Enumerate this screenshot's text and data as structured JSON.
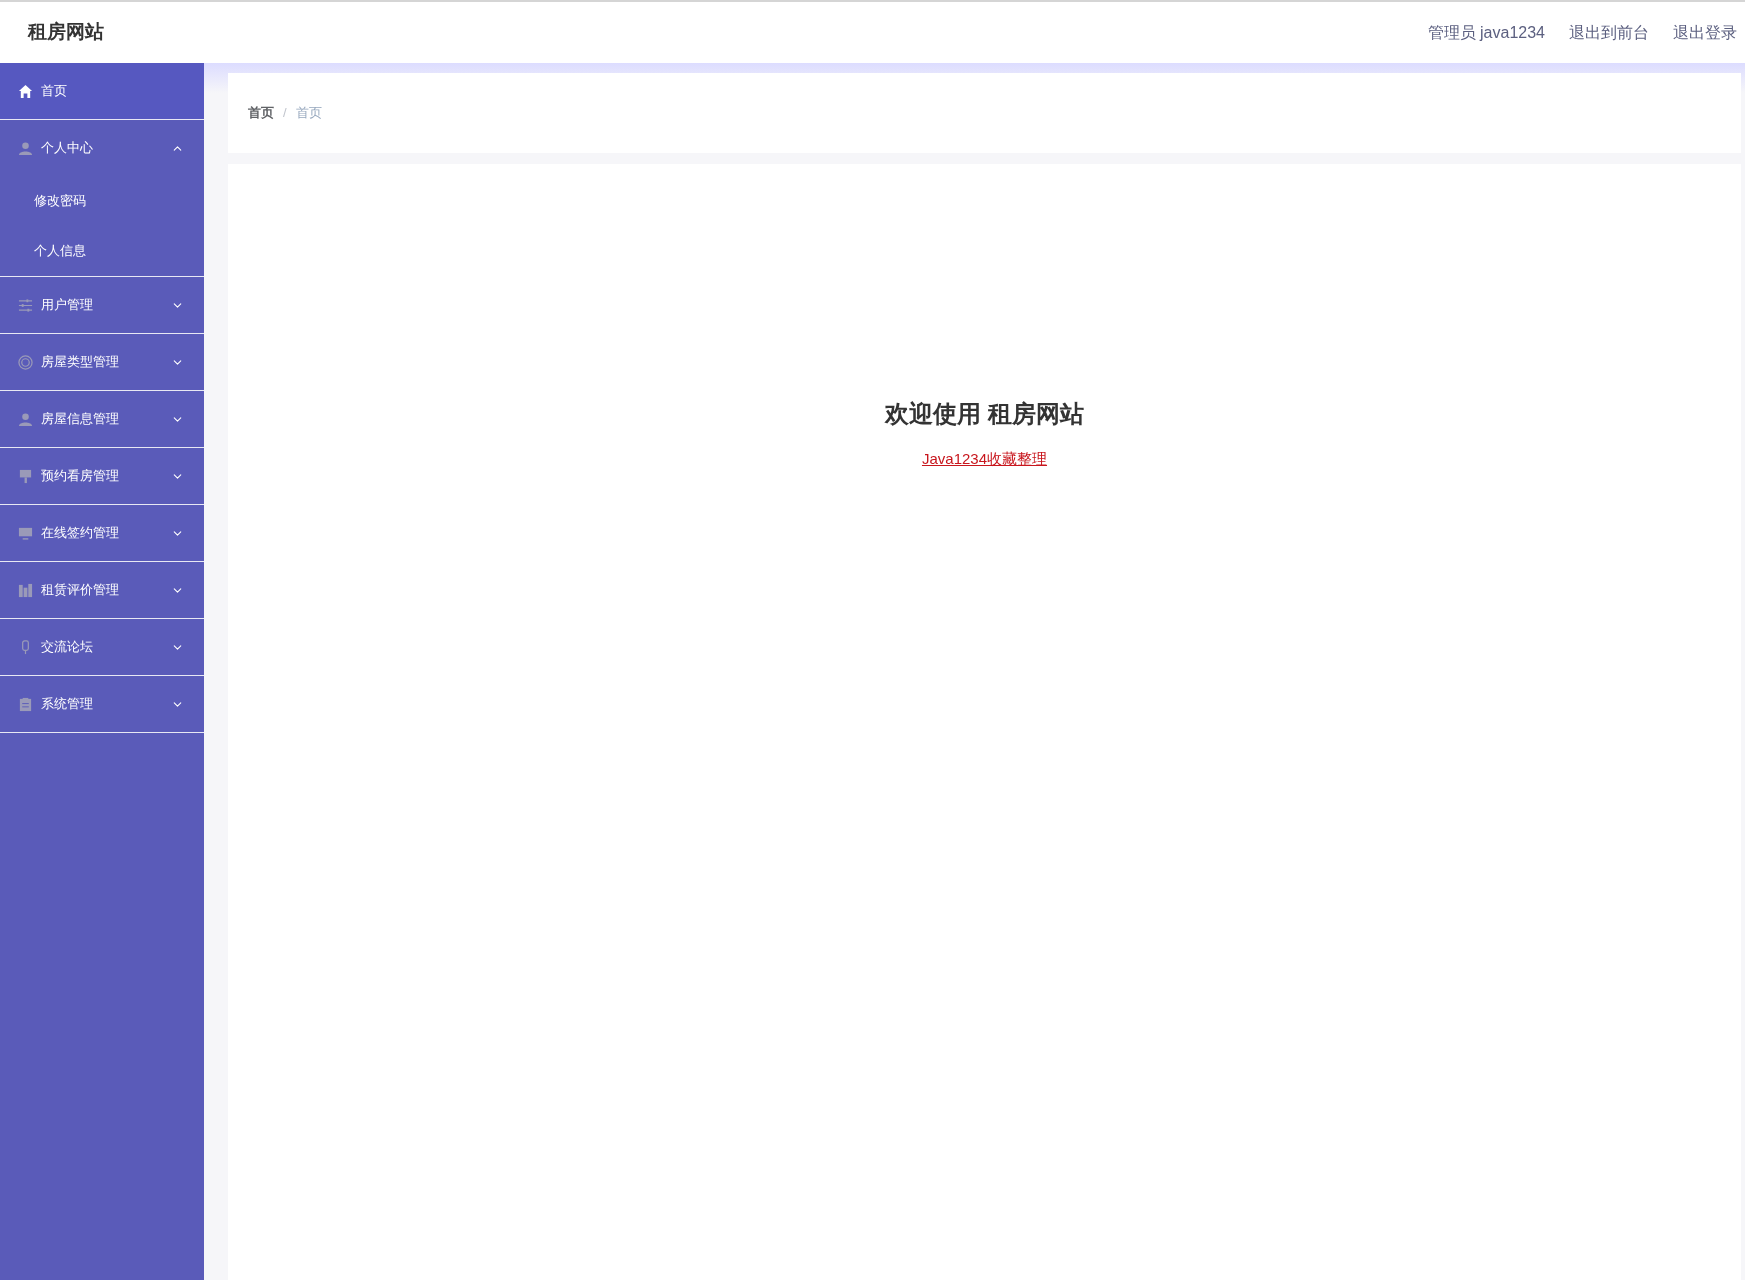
{
  "header": {
    "title": "租房网站",
    "links": [
      "管理员 java1234",
      "退出到前台",
      "退出登录"
    ]
  },
  "sidebar": {
    "items": [
      {
        "label": "首页",
        "kind": "link",
        "selected": true
      },
      {
        "label": "个人中心",
        "kind": "group",
        "expanded": true,
        "children": [
          {
            "label": "修改密码"
          },
          {
            "label": "个人信息"
          }
        ]
      },
      {
        "label": "用户管理",
        "kind": "group",
        "expanded": false
      },
      {
        "label": "房屋类型管理",
        "kind": "group",
        "expanded": false
      },
      {
        "label": "房屋信息管理",
        "kind": "group",
        "expanded": false
      },
      {
        "label": "预约看房管理",
        "kind": "group",
        "expanded": false
      },
      {
        "label": "在线签约管理",
        "kind": "group",
        "expanded": false
      },
      {
        "label": "租赁评价管理",
        "kind": "group",
        "expanded": false
      },
      {
        "label": "交流论坛",
        "kind": "group",
        "expanded": false
      },
      {
        "label": "系统管理",
        "kind": "group",
        "expanded": false
      }
    ]
  },
  "breadcrumb": {
    "items": [
      "首页",
      "首页"
    ],
    "separator": "/"
  },
  "welcome": {
    "title": "欢迎使用 租房网站",
    "link": "Java1234收藏整理"
  }
}
